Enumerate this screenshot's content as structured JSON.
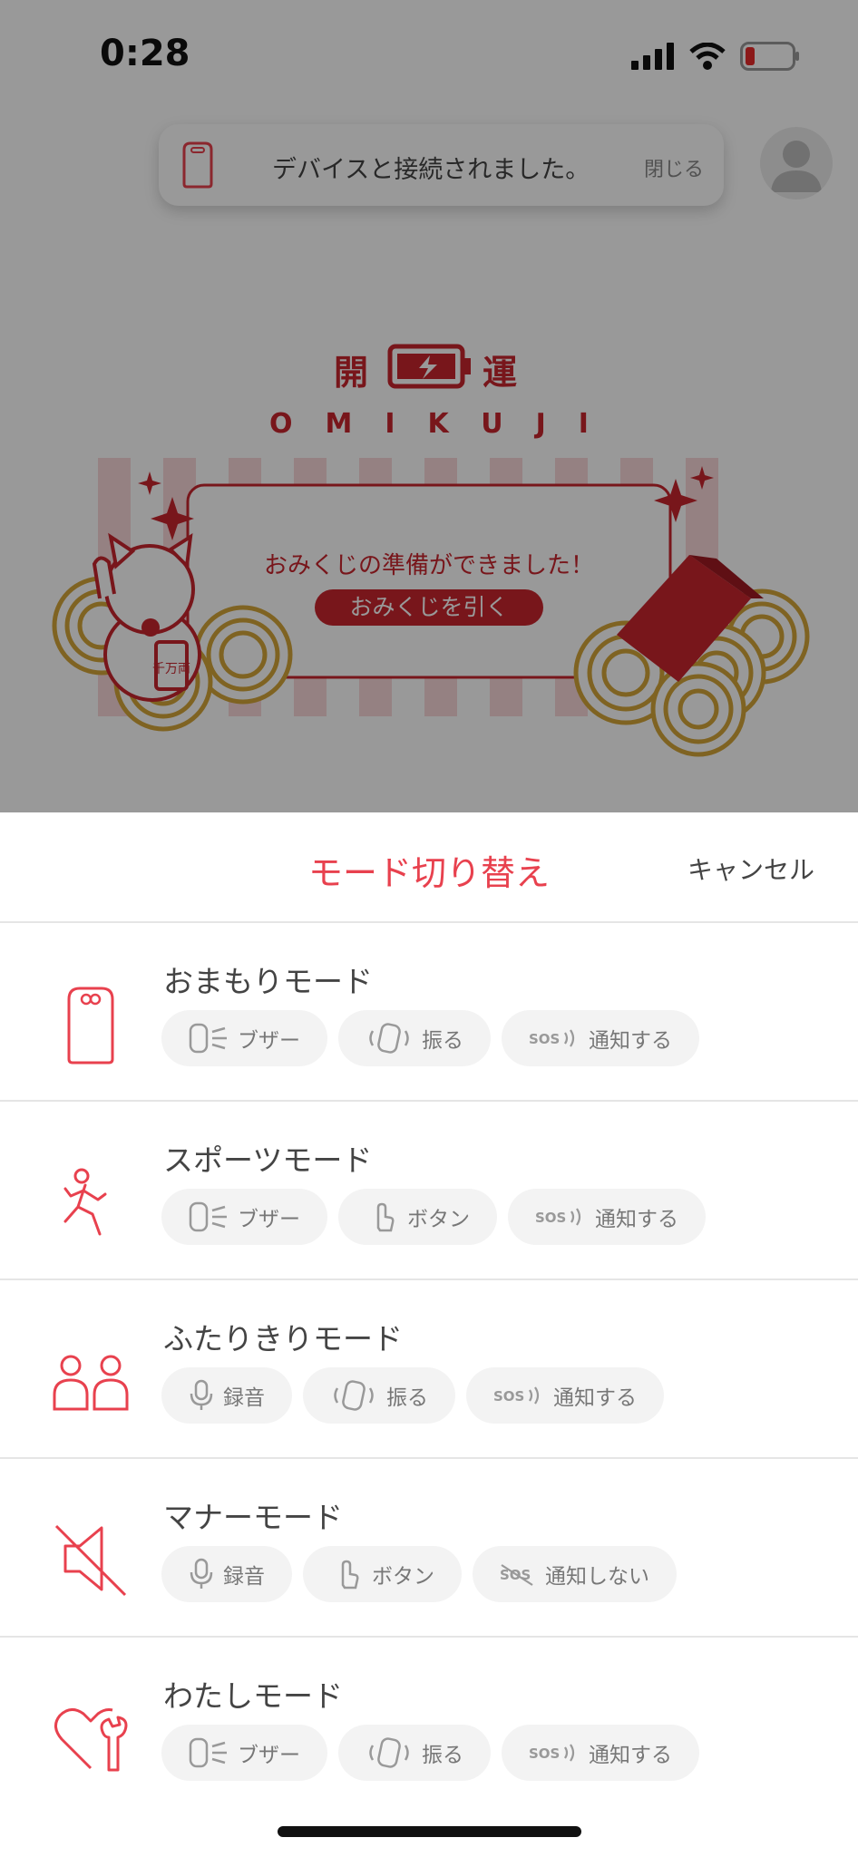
{
  "status_bar": {
    "time": "0:28"
  },
  "toast": {
    "message": "デバイスと接続されました。",
    "close_label": "閉じる"
  },
  "omikuji": {
    "title_left": "開",
    "title_right": "運",
    "subtitle": "OMIKUJI",
    "ready_text": "おみくじの準備ができました！",
    "draw_button": "おみくじを引く",
    "cat_tag": "千万両"
  },
  "sheet": {
    "title": "モード切り替え",
    "cancel": "キャンセル",
    "modes": [
      {
        "name": "おまもりモード",
        "icon": "omamori-icon",
        "chips": [
          {
            "icon": "buzzer-icon",
            "label": "ブザー"
          },
          {
            "icon": "shake-icon",
            "label": "振る"
          },
          {
            "icon": "sos-icon",
            "label": "通知する"
          }
        ]
      },
      {
        "name": "スポーツモード",
        "icon": "running-person-icon",
        "chips": [
          {
            "icon": "buzzer-icon",
            "label": "ブザー"
          },
          {
            "icon": "tap-button-icon",
            "label": "ボタン"
          },
          {
            "icon": "sos-icon",
            "label": "通知する"
          }
        ]
      },
      {
        "name": "ふたりきりモード",
        "icon": "two-people-icon",
        "chips": [
          {
            "icon": "microphone-icon",
            "label": "録音"
          },
          {
            "icon": "shake-icon",
            "label": "振る"
          },
          {
            "icon": "sos-icon",
            "label": "通知する"
          }
        ]
      },
      {
        "name": "マナーモード",
        "icon": "mute-speaker-icon",
        "chips": [
          {
            "icon": "microphone-icon",
            "label": "録音"
          },
          {
            "icon": "tap-button-icon",
            "label": "ボタン"
          },
          {
            "icon": "sos-off-icon",
            "label": "通知しない"
          }
        ]
      },
      {
        "name": "わたしモード",
        "icon": "heart-wrench-icon",
        "chips": [
          {
            "icon": "buzzer-icon",
            "label": "ブザー"
          },
          {
            "icon": "shake-icon",
            "label": "振る"
          },
          {
            "icon": "sos-icon",
            "label": "通知する"
          }
        ]
      }
    ]
  },
  "colors": {
    "accent": "#e8414e",
    "omikuji_red": "#c8252e",
    "gold": "#d4a63a"
  }
}
